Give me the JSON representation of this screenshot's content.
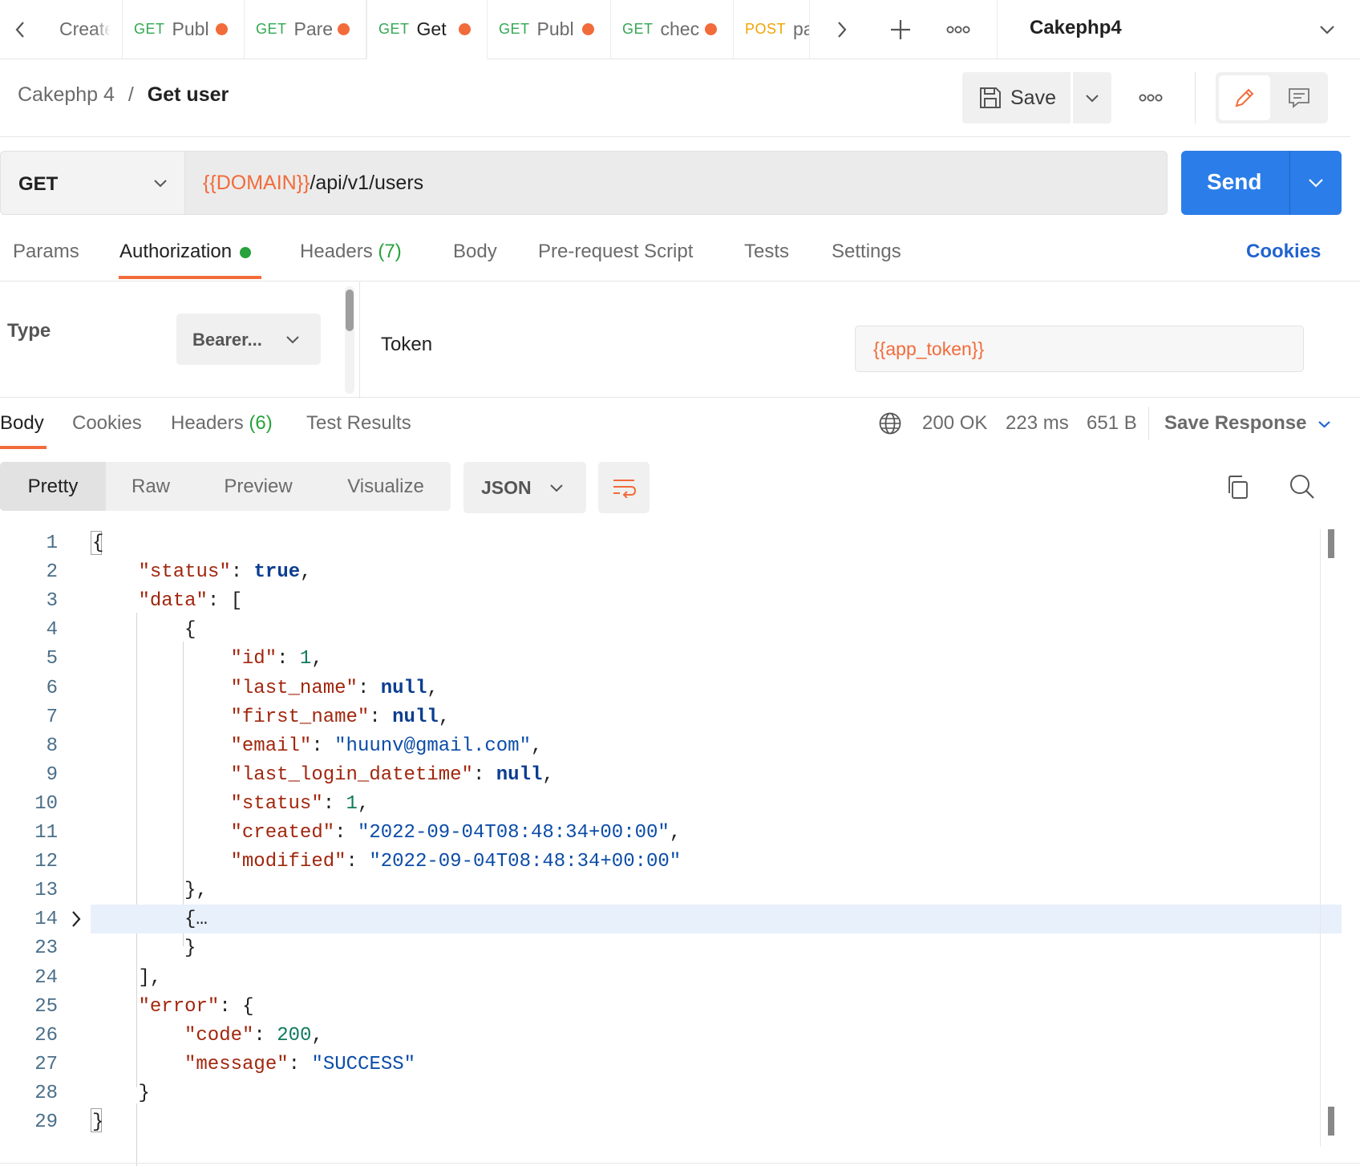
{
  "tabs": [
    {
      "method": "",
      "label": "Create",
      "dot": false
    },
    {
      "method": "GET",
      "label": "Publ",
      "dot": true
    },
    {
      "method": "GET",
      "label": "Pare",
      "dot": true
    },
    {
      "method": "GET",
      "label": "Get",
      "dot": true,
      "active": true
    },
    {
      "method": "GET",
      "label": "Publ",
      "dot": true
    },
    {
      "method": "GET",
      "label": "chec",
      "dot": true
    },
    {
      "method": "POST",
      "label": "pa",
      "dot": false
    }
  ],
  "workspace": "Cakephp4",
  "breadcrumb": {
    "collection": "Cakephp 4",
    "separator": "/",
    "request": "Get user"
  },
  "header": {
    "save_label": "Save"
  },
  "request": {
    "method": "GET",
    "url_var": "{{DOMAIN}}",
    "url_path": "/api/v1/users",
    "send_label": "Send"
  },
  "request_tabs": {
    "params": "Params",
    "authorization": "Authorization",
    "headers": "Headers",
    "headers_count": "(7)",
    "body": "Body",
    "prerequest": "Pre-request Script",
    "tests": "Tests",
    "settings": "Settings",
    "cookies": "Cookies"
  },
  "auth": {
    "type_label": "Type",
    "type_value": "Bearer...",
    "token_label": "Token",
    "token_value": "{{app_token}}"
  },
  "response_tabs": {
    "body": "Body",
    "cookies": "Cookies",
    "headers": "Headers",
    "headers_count": "(6)",
    "test_results": "Test Results"
  },
  "response_meta": {
    "status": "200 OK",
    "time": "223 ms",
    "size": "651 B",
    "save_response": "Save Response"
  },
  "view_modes": {
    "pretty": "Pretty",
    "raw": "Raw",
    "preview": "Preview",
    "visualize": "Visualize",
    "format": "JSON"
  },
  "code_lines": [
    {
      "n": "1",
      "indent": 0,
      "parts": [
        [
          "p",
          "{"
        ]
      ]
    },
    {
      "n": "2",
      "indent": 1,
      "parts": [
        [
          "k",
          "\"status\""
        ],
        [
          "p",
          ": "
        ],
        [
          "kw",
          "true"
        ],
        [
          "p",
          ","
        ]
      ]
    },
    {
      "n": "3",
      "indent": 1,
      "parts": [
        [
          "k",
          "\"data\""
        ],
        [
          "p",
          ": ["
        ]
      ]
    },
    {
      "n": "4",
      "indent": 2,
      "parts": [
        [
          "p",
          "{"
        ]
      ]
    },
    {
      "n": "5",
      "indent": 3,
      "parts": [
        [
          "k",
          "\"id\""
        ],
        [
          "p",
          ": "
        ],
        [
          "n",
          "1"
        ],
        [
          "p",
          ","
        ]
      ]
    },
    {
      "n": "6",
      "indent": 3,
      "parts": [
        [
          "k",
          "\"last_name\""
        ],
        [
          "p",
          ": "
        ],
        [
          "kw",
          "null"
        ],
        [
          "p",
          ","
        ]
      ]
    },
    {
      "n": "7",
      "indent": 3,
      "parts": [
        [
          "k",
          "\"first_name\""
        ],
        [
          "p",
          ": "
        ],
        [
          "kw",
          "null"
        ],
        [
          "p",
          ","
        ]
      ]
    },
    {
      "n": "8",
      "indent": 3,
      "parts": [
        [
          "k",
          "\"email\""
        ],
        [
          "p",
          ": "
        ],
        [
          "s",
          "\"huunv@gmail.com\""
        ],
        [
          "p",
          ","
        ]
      ]
    },
    {
      "n": "9",
      "indent": 3,
      "parts": [
        [
          "k",
          "\"last_login_datetime\""
        ],
        [
          "p",
          ": "
        ],
        [
          "kw",
          "null"
        ],
        [
          "p",
          ","
        ]
      ]
    },
    {
      "n": "10",
      "indent": 3,
      "parts": [
        [
          "k",
          "\"status\""
        ],
        [
          "p",
          ": "
        ],
        [
          "n",
          "1"
        ],
        [
          "p",
          ","
        ]
      ]
    },
    {
      "n": "11",
      "indent": 3,
      "parts": [
        [
          "k",
          "\"created\""
        ],
        [
          "p",
          ": "
        ],
        [
          "s",
          "\"2022-09-04T08:48:34+00:00\""
        ],
        [
          "p",
          ","
        ]
      ]
    },
    {
      "n": "12",
      "indent": 3,
      "parts": [
        [
          "k",
          "\"modified\""
        ],
        [
          "p",
          ": "
        ],
        [
          "s",
          "\"2022-09-04T08:48:34+00:00\""
        ]
      ]
    },
    {
      "n": "13",
      "indent": 2,
      "parts": [
        [
          "p",
          "},"
        ]
      ]
    },
    {
      "n": "14",
      "indent": 2,
      "parts": [
        [
          "p",
          "{…"
        ]
      ],
      "folded": true
    },
    {
      "n": "23",
      "indent": 2,
      "parts": [
        [
          "p",
          "}"
        ]
      ]
    },
    {
      "n": "24",
      "indent": 1,
      "parts": [
        [
          "p",
          "],"
        ]
      ]
    },
    {
      "n": "25",
      "indent": 1,
      "parts": [
        [
          "k",
          "\"error\""
        ],
        [
          "p",
          ": {"
        ]
      ]
    },
    {
      "n": "26",
      "indent": 2,
      "parts": [
        [
          "k",
          "\"code\""
        ],
        [
          "p",
          ": "
        ],
        [
          "n",
          "200"
        ],
        [
          "p",
          ","
        ]
      ]
    },
    {
      "n": "27",
      "indent": 2,
      "parts": [
        [
          "k",
          "\"message\""
        ],
        [
          "p",
          ": "
        ],
        [
          "s",
          "\"SUCCESS\""
        ]
      ]
    },
    {
      "n": "28",
      "indent": 1,
      "parts": [
        [
          "p",
          "}"
        ]
      ]
    },
    {
      "n": "29",
      "indent": 0,
      "parts": [
        [
          "p",
          "}"
        ]
      ]
    }
  ],
  "colors": {
    "accent": "#f26b3a",
    "send": "#2b7de9",
    "link": "#2163cf",
    "ok": "#27a23c"
  },
  "icons": [
    "chevron-left-icon",
    "chevron-right-icon",
    "plus-icon",
    "more-icon",
    "chevron-down-icon",
    "save-icon",
    "edit-icon",
    "comment-icon",
    "globe-icon",
    "wrap-icon",
    "copy-icon",
    "search-icon",
    "fold-arrow-icon"
  ]
}
